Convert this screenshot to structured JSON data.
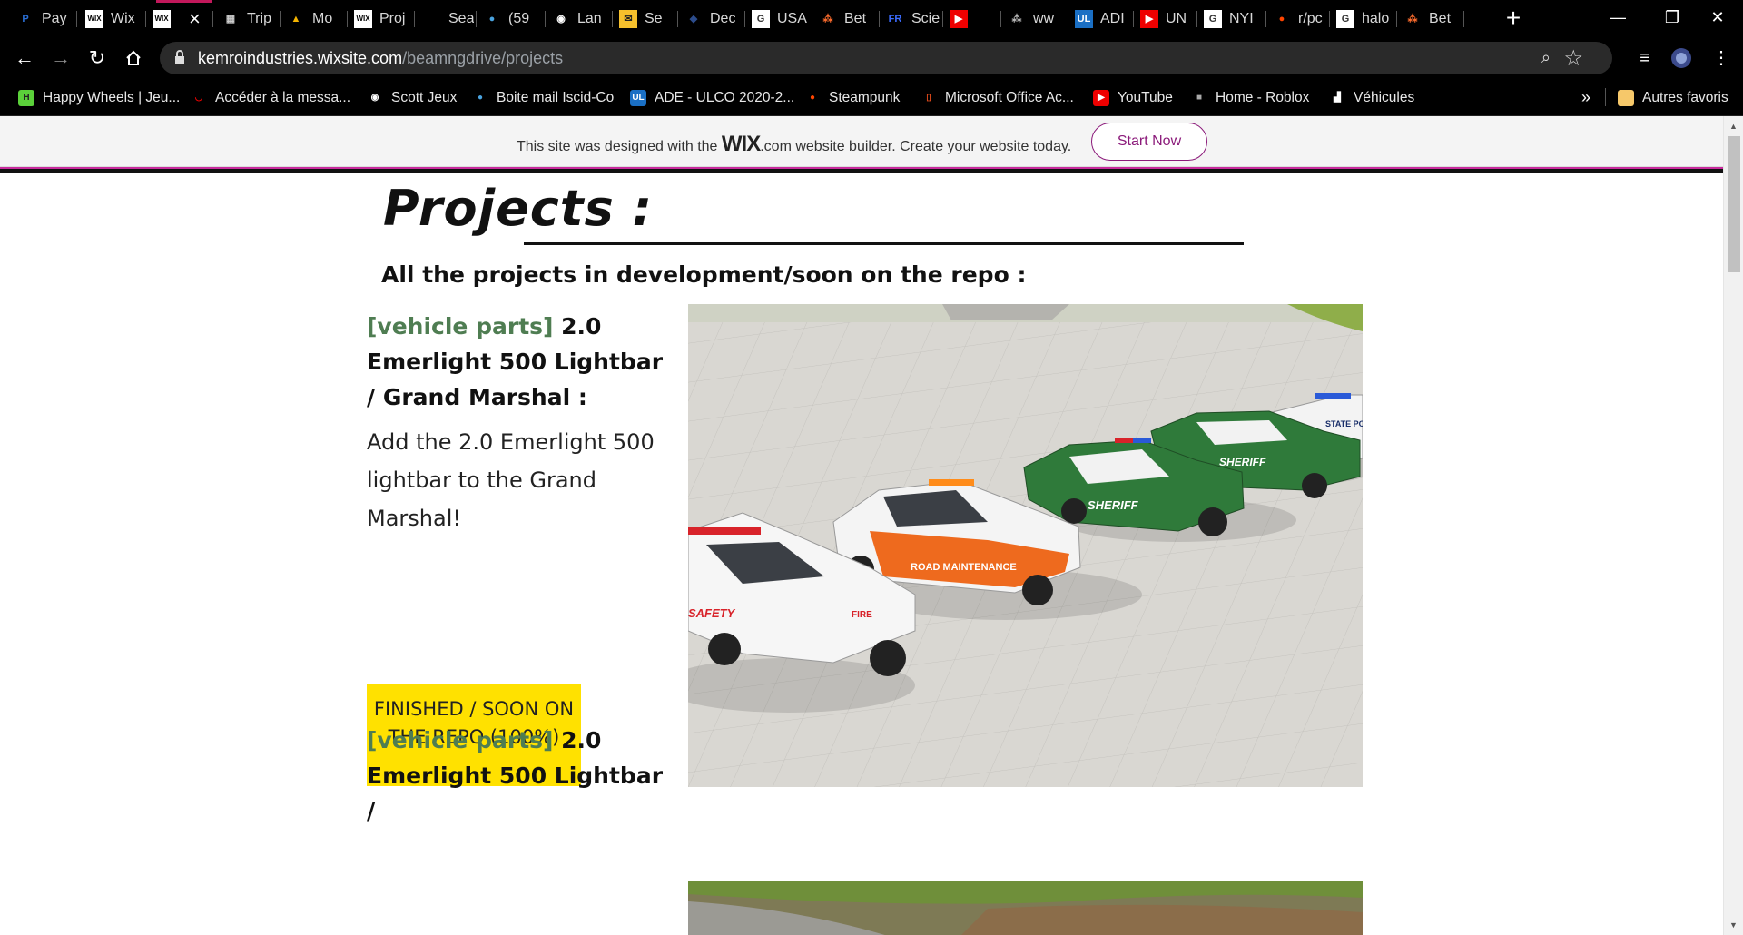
{
  "browser": {
    "tabs": [
      {
        "title": "Pay",
        "icon": "paypal-icon",
        "favText": "P",
        "favColor": "#2a6fd6",
        "favBg": "transparent"
      },
      {
        "title": "Wix",
        "icon": "wix-icon",
        "favText": "WIX",
        "favColor": "#000",
        "favBg": "#fff"
      },
      {
        "title": "",
        "icon": "wix-icon",
        "favText": "WIX",
        "favColor": "#000",
        "favBg": "#fff",
        "active": true
      },
      {
        "title": "Trip",
        "icon": "image-icon",
        "favText": "▦",
        "favColor": "#ccc",
        "favBg": "transparent"
      },
      {
        "title": "Mo",
        "icon": "drive-icon",
        "favText": "▲",
        "favColor": "#f4b400",
        "favBg": "transparent"
      },
      {
        "title": "Proj",
        "icon": "wix-icon",
        "favText": "WIX",
        "favColor": "#000",
        "favBg": "#fff"
      },
      {
        "title": "Sea",
        "icon": "blank-icon",
        "favText": "",
        "favColor": "#fff",
        "favBg": "transparent"
      },
      {
        "title": "(59",
        "icon": "cloud-icon",
        "favText": "●",
        "favColor": "#4aa3df",
        "favBg": "transparent"
      },
      {
        "title": "Lan",
        "icon": "globe-icon",
        "favText": "◉",
        "favColor": "#fff",
        "favBg": "transparent"
      },
      {
        "title": "Se",
        "icon": "mail-icon",
        "favText": "✉",
        "favColor": "#222",
        "favBg": "#f6c02c"
      },
      {
        "title": "Dec",
        "icon": "shield-icon",
        "favText": "◆",
        "favColor": "#2c4c8c",
        "favBg": "transparent"
      },
      {
        "title": "USA",
        "icon": "google-icon",
        "favText": "G",
        "favColor": "#333",
        "favBg": "#fff"
      },
      {
        "title": "Bet",
        "icon": "dots-icon",
        "favText": "⁂",
        "favColor": "#ff6d2d",
        "favBg": "transparent"
      },
      {
        "title": "Scie",
        "icon": "fr-icon",
        "favText": "FR",
        "favColor": "#3b6cff",
        "favBg": "transparent"
      },
      {
        "title": "",
        "icon": "youtube-icon",
        "favText": "▶",
        "favColor": "#fff",
        "favBg": "#e00"
      },
      {
        "title": "ww",
        "icon": "dots-icon",
        "favText": "⁂",
        "favColor": "#bbb",
        "favBg": "transparent"
      },
      {
        "title": "ADI",
        "icon": "ulco-icon",
        "favText": "UL",
        "favColor": "#fff",
        "favBg": "#1a6fc4"
      },
      {
        "title": "UN",
        "icon": "youtube-icon",
        "favText": "▶",
        "favColor": "#fff",
        "favBg": "#e00"
      },
      {
        "title": "NYI",
        "icon": "google-icon",
        "favText": "G",
        "favColor": "#333",
        "favBg": "#fff"
      },
      {
        "title": "r/pc",
        "icon": "reddit-icon",
        "favText": "●",
        "favColor": "#ff4500",
        "favBg": "transparent"
      },
      {
        "title": "halo",
        "icon": "google-icon",
        "favText": "G",
        "favColor": "#333",
        "favBg": "#fff"
      },
      {
        "title": "Bet",
        "icon": "dots-icon",
        "favText": "⁂",
        "favColor": "#ff6d2d",
        "favBg": "transparent"
      }
    ],
    "url_host": "kemroindustries.wixsite.com",
    "url_path": "/beamngdrive/projects",
    "bookmarks": [
      {
        "label": "Happy Wheels | Jeu...",
        "icon": "happy-wheels-icon",
        "favText": "H",
        "favColor": "#222",
        "favBg": "#5bd13a"
      },
      {
        "label": "Accéder à la messa...",
        "icon": "mail-smile-icon",
        "favText": "◡",
        "favColor": "#e00",
        "favBg": "transparent"
      },
      {
        "label": "Scott Jeux",
        "icon": "globe-icon",
        "favText": "◉",
        "favColor": "#fff",
        "favBg": "transparent"
      },
      {
        "label": "Boite mail Iscid-Co",
        "icon": "cloud-icon",
        "favText": "●",
        "favColor": "#4aa3df",
        "favBg": "transparent"
      },
      {
        "label": "ADE - ULCO 2020-2...",
        "icon": "ulco-icon",
        "favText": "UL",
        "favColor": "#fff",
        "favBg": "#1a6fc4"
      },
      {
        "label": "Steampunk",
        "icon": "reddit-icon",
        "favText": "●",
        "favColor": "#ff4500",
        "favBg": "transparent"
      },
      {
        "label": "Microsoft Office Ac...",
        "icon": "office-icon",
        "favText": "▯",
        "favColor": "#e04a1b",
        "favBg": "transparent"
      },
      {
        "label": "YouTube",
        "icon": "youtube-icon",
        "favText": "▶",
        "favColor": "#fff",
        "favBg": "#e00"
      },
      {
        "label": "Home - Roblox",
        "icon": "roblox-icon",
        "favText": "■",
        "favColor": "#aaa",
        "favBg": "transparent"
      },
      {
        "label": "Véhicules",
        "icon": "vehicles-icon",
        "favText": "▟",
        "favColor": "#fff",
        "favBg": "transparent"
      }
    ],
    "more_label": "»",
    "other_bookmarks": "Autres favoris"
  },
  "wix_banner": {
    "prefix": "This site was designed with the",
    "brand": "WIX",
    "suffix": ".com website builder. Create your website today.",
    "button": "Start Now"
  },
  "page": {
    "heading": "Projects :",
    "subheading": "All the projects in development/soon on the repo :",
    "projects": [
      {
        "category": "[vehicle parts]",
        "title": " 2.0 Emerlight 500 Lightbar / Grand Marshal :",
        "description": "Add the 2.0 Emerlight 500 lightbar to the Grand Marshal!",
        "status": "FINISHED / SOON ON THE REPO (100%)",
        "image_vehicle_labels": [
          "SAFETY",
          "FIRE",
          "ROAD MAINTENANCE",
          "SHERIFF",
          "SHERIFF",
          "STATE POLICE"
        ]
      },
      {
        "category": "[vehicle parts]",
        "title": " 2.0 Emerlight 500 Lightbar /"
      }
    ]
  },
  "colors": {
    "category_green": "#4f7d52",
    "status_yellow": "#ffe100",
    "wix_purple": "#8b1a7a",
    "accent_pink": "#c82b9d"
  }
}
